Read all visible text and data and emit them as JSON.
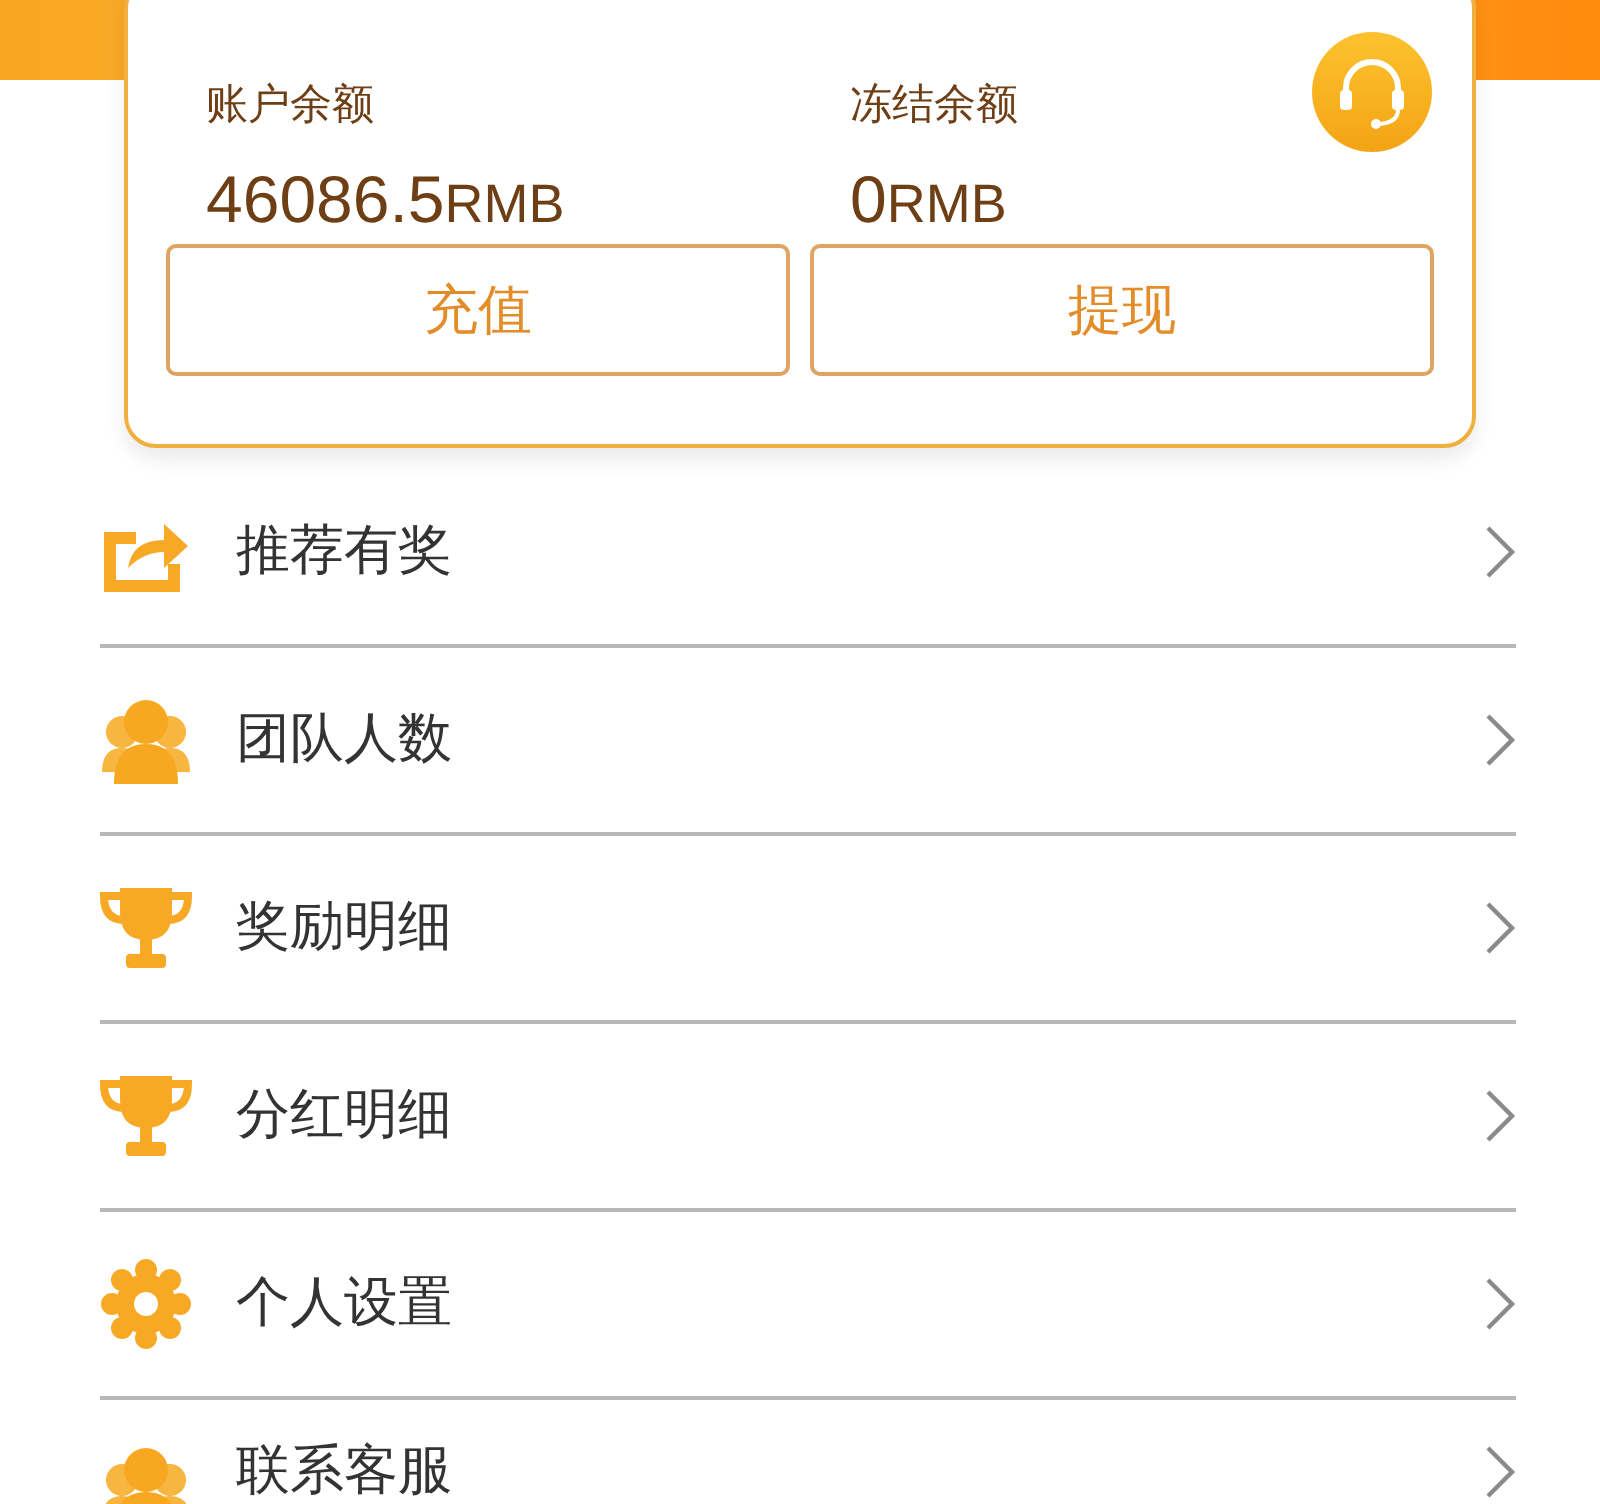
{
  "account": {
    "balances": [
      {
        "label": "账户余额",
        "amount": "46086.5",
        "unit": "RMB"
      },
      {
        "label": "冻结余额",
        "amount": "0",
        "unit": "RMB"
      }
    ],
    "buttons": [
      "充值",
      "提现"
    ]
  },
  "menu": [
    {
      "kind": "share",
      "label": "推荐有奖"
    },
    {
      "kind": "people",
      "label": "团队人数"
    },
    {
      "kind": "trophy",
      "label": "奖励明细"
    },
    {
      "kind": "trophy",
      "label": "分红明细"
    },
    {
      "kind": "gear",
      "label": "个人设置"
    },
    {
      "kind": "people",
      "label": "联系客服"
    }
  ]
}
